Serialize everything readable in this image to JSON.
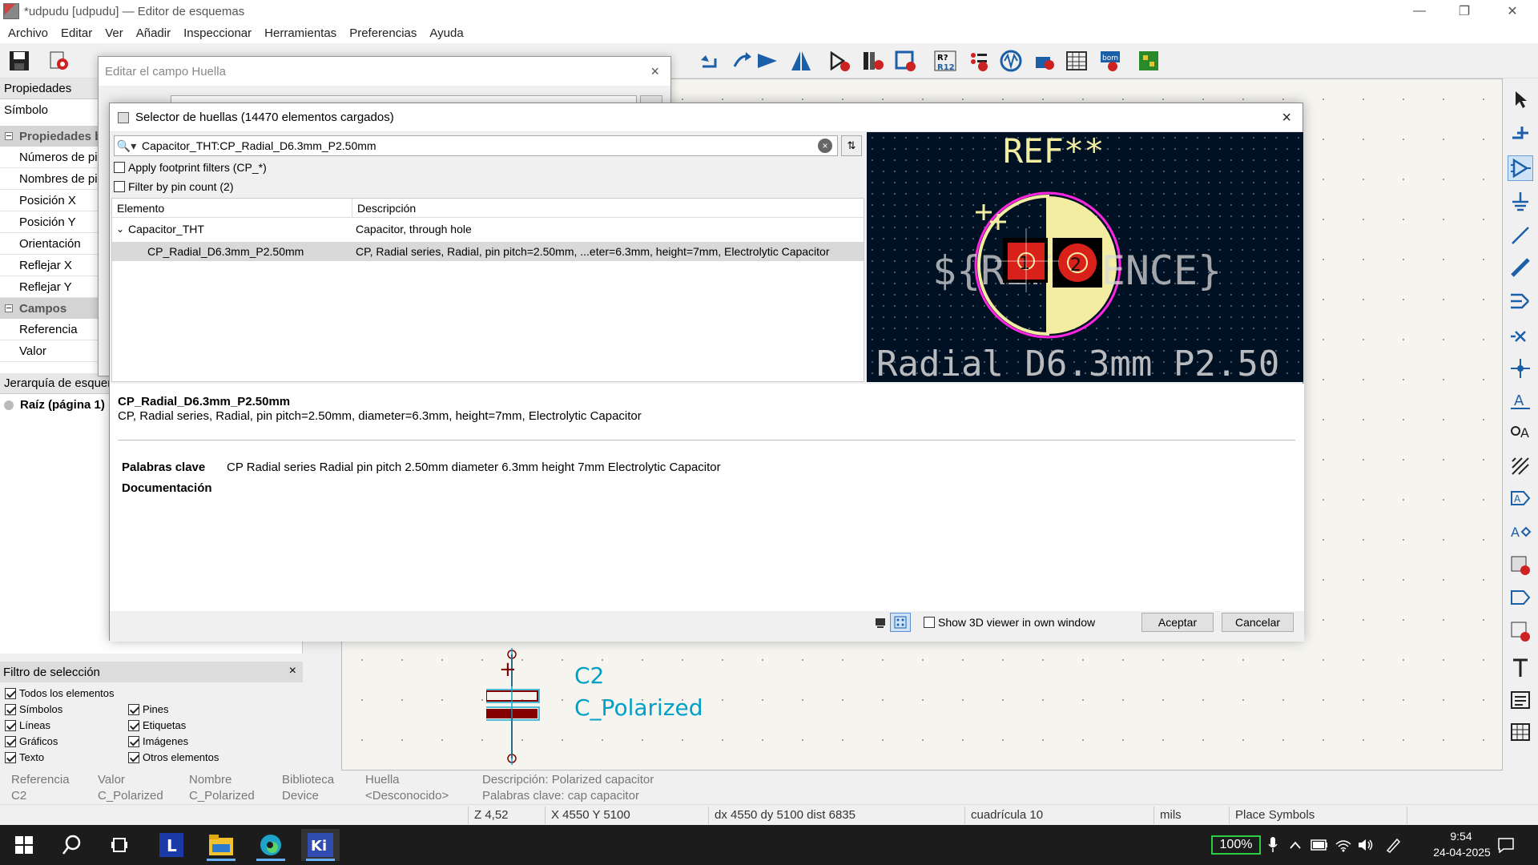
{
  "window": {
    "title": "*udpudu [udpudu] — Editor de esquemas"
  },
  "menu": [
    "Archivo",
    "Editar",
    "Ver",
    "Añadir",
    "Inspeccionar",
    "Herramientas",
    "Preferencias",
    "Ayuda"
  ],
  "left_panel": {
    "properties_header": "Propiedades",
    "symbol_label": "Símbolo",
    "group_basic": "Propiedades b",
    "basic_rows": [
      "Números de pi",
      "Nombres de pi",
      "Posición X",
      "Posición Y",
      "Orientación",
      "Reflejar X",
      "Reflejar Y"
    ],
    "group_fields": "Campos",
    "field_rows": [
      "Referencia",
      "Valor"
    ],
    "hierarchy_header": "Jerarquía de esquem",
    "hierarchy_root": "Raíz (página 1)"
  },
  "selection_filter": {
    "header": "Filtro de selección",
    "close": "×",
    "items_left": [
      "Todos los elementos",
      "Símbolos",
      "Líneas",
      "Gráficos",
      "Texto"
    ],
    "items_right": [
      "Pines",
      "Etiquetas",
      "Imágenes",
      "Otros elementos"
    ]
  },
  "field_dialog": {
    "title": "Editar el campo Huella",
    "close": "×"
  },
  "chooser": {
    "title": "Selector de huellas (14470 elementos cargados)",
    "close": "×",
    "search_value": "Capacitor_THT:CP_Radial_D6.3mm_P2.50mm",
    "clear": "×",
    "filter_cp": "Apply footprint filters (CP_*)",
    "filter_pins": "Filter by pin count (2)",
    "col_element": "Elemento",
    "col_description": "Descripción",
    "group_name": "Capacitor_THT",
    "group_desc": "Capacitor, through hole",
    "item_name": "CP_Radial_D6.3mm_P2.50mm",
    "item_desc": "CP, Radial series, Radial, pin pitch=2.50mm, ...eter=6.3mm, height=7mm, Electrolytic Capacitor",
    "preview": {
      "ref": "REF**",
      "reference_var": "${REFERENCE}",
      "value": "Radial_D6.3mm_P2.50",
      "pad1": "1",
      "pad2": "2"
    },
    "detail_name": "CP_Radial_D6.3mm_P2.50mm",
    "detail_desc": "CP, Radial series, Radial, pin pitch=2.50mm, diameter=6.3mm, height=7mm, Electrolytic Capacitor",
    "keywords_label": "Palabras clave",
    "keywords_value": "CP Radial series Radial pin pitch 2.50mm diameter 6.3mm height 7mm Electrolytic Capacitor",
    "docs_label": "Documentación",
    "show_3d": "Show 3D viewer in own window",
    "accept": "Aceptar",
    "cancel": "Cancelar"
  },
  "schematic": {
    "ref": "C2",
    "value": "C_Polarized",
    "plus": "+"
  },
  "info_bar": [
    {
      "label": "Referencia",
      "value": "C2"
    },
    {
      "label": "Valor",
      "value": "C_Polarized"
    },
    {
      "label": "Nombre",
      "value": "C_Polarized"
    },
    {
      "label": "Biblioteca",
      "value": "Device"
    },
    {
      "label": "Huella",
      "value": "<Desconocido>"
    },
    {
      "label": "Descripción: Polarized capacitor",
      "value": "Palabras clave: cap capacitor"
    }
  ],
  "status": {
    "zoom": "Z 4,52",
    "xy": "X 4550  Y 5100",
    "dxy": "dx 4550  dy 5100  dist 6835",
    "grid": "cuadrícula 10",
    "units": "mils",
    "mode": "Place Symbols"
  },
  "taskbar": {
    "battery": "100%",
    "time": "9:54",
    "date": "24-04-2025"
  },
  "colors": {
    "pcb_bg": "#001124",
    "silk": "#f2eda1",
    "pad": "#d8211b",
    "courtyard": "#ff26e2",
    "schematic_ref": "#00a0c8",
    "symbol_body": "#840000"
  }
}
